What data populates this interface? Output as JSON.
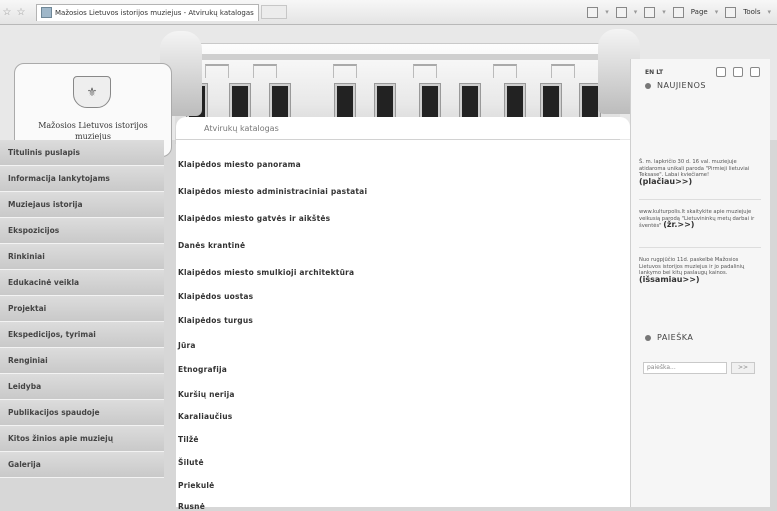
{
  "browser": {
    "tab_title": "Mažosios Lietuvos istorijos muziejus - Atvirukų katalogas",
    "page_menu": "Page",
    "tools_menu": "Tools"
  },
  "logo": {
    "name": "Mažosios Lietuvos istorijos muziejus"
  },
  "header": {
    "section_title": "Atvirukų katalogas"
  },
  "nav": {
    "items": [
      "Titulinis puslapis",
      "Informacija lankytojams",
      "Muziejaus istorija",
      "Ekspozicijos",
      "Rinkiniai",
      "Edukacinė veikla",
      "Projektai",
      "Ekspedicijos, tyrimai",
      "Renginiai",
      "Leidyba",
      "Publikacijos spaudoje",
      "Kitos žinios apie muziejų",
      "Galerija"
    ]
  },
  "catalog": {
    "items": [
      "Klaipėdos miesto panorama",
      "Klaipėdos miesto administraciniai pastatai",
      "Klaipėdos miesto gatvės ir aikštės",
      "Danės krantinė",
      "Klaipėdos miesto smulkioji architektūra",
      "Klaipėdos uostas",
      "Klaipėdos turgus",
      "Jūra",
      "Etnografija",
      "Kuršių nerija",
      "Karaliaučius",
      "Tilžė",
      "Šilutė",
      "Priekulė",
      "Rusnė"
    ]
  },
  "sidebar": {
    "languages": "EN LT",
    "news_title": "NAUJIENOS",
    "news": [
      {
        "text": "Š. m. lapkričio 30 d. 16 val. muziejuje atidaroma unikali paroda \"Pirmieji lietuviai Teksase\". Labai kviečiame!",
        "more": "(plačiau>>)"
      },
      {
        "text": "www.kulturpolis.lt skaitykite apie muziejuje veikusią parodą \"Lietuvininkų metų darbai ir šventės\"",
        "more": "(žr.>>)"
      },
      {
        "text": "Nuo rugpjūčio 11d. paskelbė Mažosios Lietuvos istorijos muziejus ir jo padalinių lankymo bei kitų paslaugų kainos.",
        "more": "(išsamiau>>)"
      }
    ],
    "search_title": "PAIEŠKA",
    "search_placeholder": "paieška...",
    "search_button": ">>"
  }
}
